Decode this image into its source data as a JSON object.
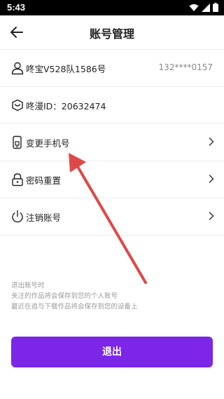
{
  "status_bar": {
    "time": "5:43"
  },
  "header": {
    "title": "账号管理"
  },
  "rows": [
    {
      "label": "咚宝V528队1586号",
      "value": "132****0157",
      "icon": "user-icon"
    },
    {
      "label": "咚漫ID：20632474",
      "icon": "badge-icon"
    },
    {
      "label": "变更手机号",
      "icon": "phone-icon",
      "chevron": true
    },
    {
      "label": "密码重置",
      "icon": "lock-icon",
      "chevron": true
    },
    {
      "label": "注销账号",
      "icon": "power-icon",
      "chevron": true
    }
  ],
  "notes": [
    "退出账号时",
    "关注的作品将会保存到您的个人账号",
    "最近在追与下载作品将会保存到您的设备上"
  ],
  "logout": {
    "label": "退出"
  },
  "colors": {
    "accent": "#7c26e8",
    "annotation_arrow": "#e04848"
  }
}
